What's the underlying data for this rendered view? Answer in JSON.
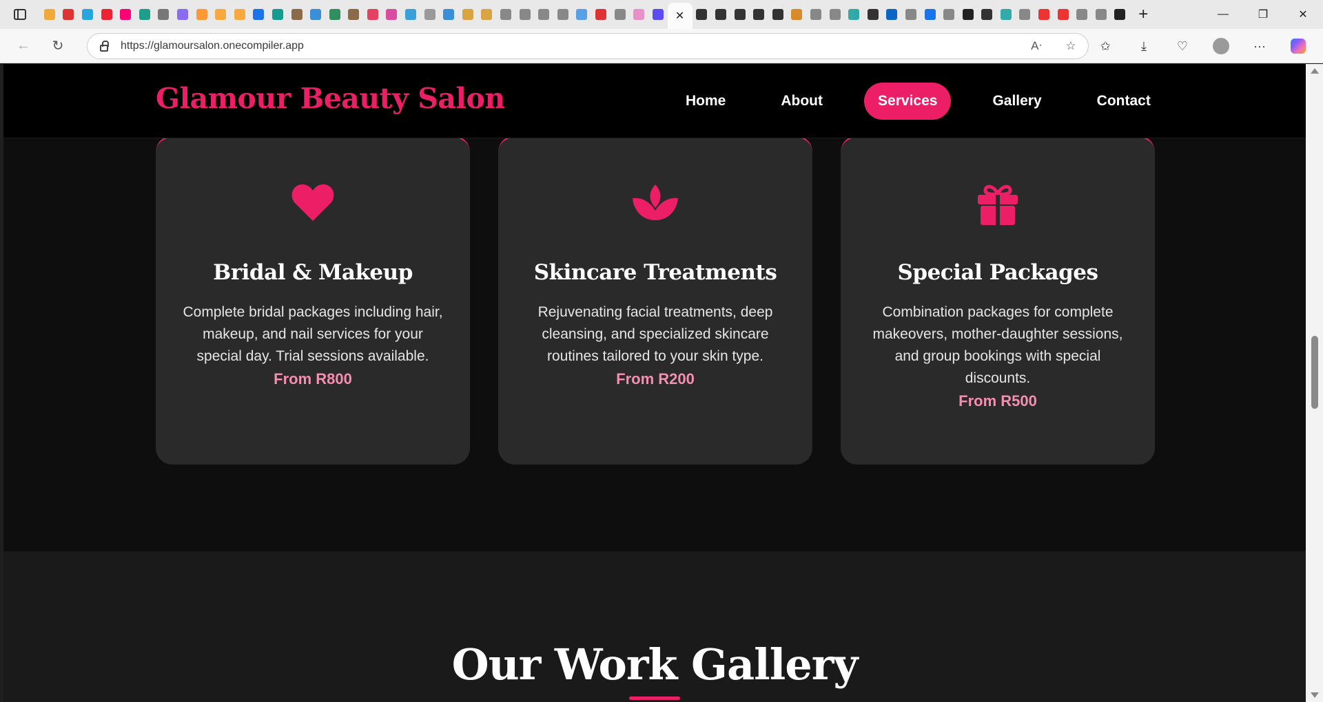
{
  "browser": {
    "url": "https://glamoursalon.onecompiler.app",
    "tab_icon_colors": [
      "#f2a93b",
      "#d33",
      "#2aa4dd",
      "#e23",
      "#f07",
      "#1e9e8a",
      "#777",
      "#8a6cf2",
      "#f93",
      "#f7a940",
      "#f7a940",
      "#1a73e8",
      "#169b91",
      "#8b6a4a",
      "#3b8ed8",
      "#2f8f5f",
      "#8b6a4a",
      "#e4405f",
      "#d94c9e",
      "#3aa0d8",
      "#999",
      "#3b8ed8",
      "#d9a441",
      "#d9a441",
      "#888",
      "#888",
      "#888",
      "#888",
      "#5aa0e6",
      "#d33",
      "#888",
      "#e890c8",
      "#5a4cf2"
    ],
    "tab_icon_colors_after": [
      "#333",
      "#333",
      "#333",
      "#333",
      "#333",
      "#d98a2b",
      "#888",
      "#888",
      "#3aa",
      "#333",
      "#0a66c2",
      "#888",
      "#1a73e8",
      "#888",
      "#222",
      "#333",
      "#3aa",
      "#888",
      "#e33",
      "#e33",
      "#888",
      "#888",
      "#222"
    ]
  },
  "site": {
    "brand": "Glamour Beauty Salon",
    "accent_color": "#ec1f66",
    "nav": [
      {
        "label": "Home",
        "active": false
      },
      {
        "label": "About",
        "active": false
      },
      {
        "label": "Services",
        "active": true
      },
      {
        "label": "Gallery",
        "active": false
      },
      {
        "label": "Contact",
        "active": false
      }
    ]
  },
  "services": [
    {
      "icon": "heart-icon",
      "title": "Bridal & Makeup",
      "description": "Complete bridal packages including hair, makeup, and nail services for your special day. Trial sessions available.",
      "price": "From R800"
    },
    {
      "icon": "lotus-icon",
      "title": "Skincare Treatments",
      "description": "Rejuvenating facial treatments, deep cleansing, and specialized skincare routines tailored to your skin type.",
      "price": "From R200"
    },
    {
      "icon": "gift-icon",
      "title": "Special Packages",
      "description": "Combination packages for complete makeovers, mother-daughter sessions, and group bookings with special discounts.",
      "price": "From R500"
    }
  ],
  "gallery": {
    "title": "Our Work Gallery"
  }
}
